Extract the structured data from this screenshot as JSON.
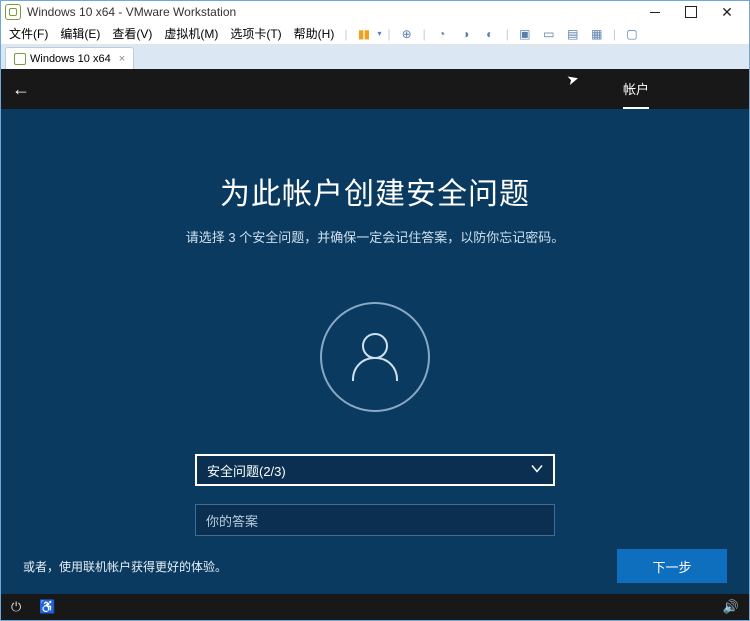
{
  "vmware": {
    "app_title": "Windows 10 x64 - VMware Workstation",
    "menu": {
      "file": "文件(F)",
      "edit": "编辑(E)",
      "view": "查看(V)",
      "vm": "虚拟机(M)",
      "tabs": "选项卡(T)",
      "help": "帮助(H)"
    },
    "tab_label": "Windows 10 x64"
  },
  "setup": {
    "top_tab": "帐户",
    "title": "为此帐户创建安全问题",
    "subtitle": "请选择 3 个安全问题，并确保一定会记住答案，以防你忘记密码。",
    "question_select": "安全问题(2/3)",
    "answer_placeholder": "你的答案",
    "alt_link": "或者，使用联机帐户获得更好的体验。",
    "next_label": "下一步"
  }
}
